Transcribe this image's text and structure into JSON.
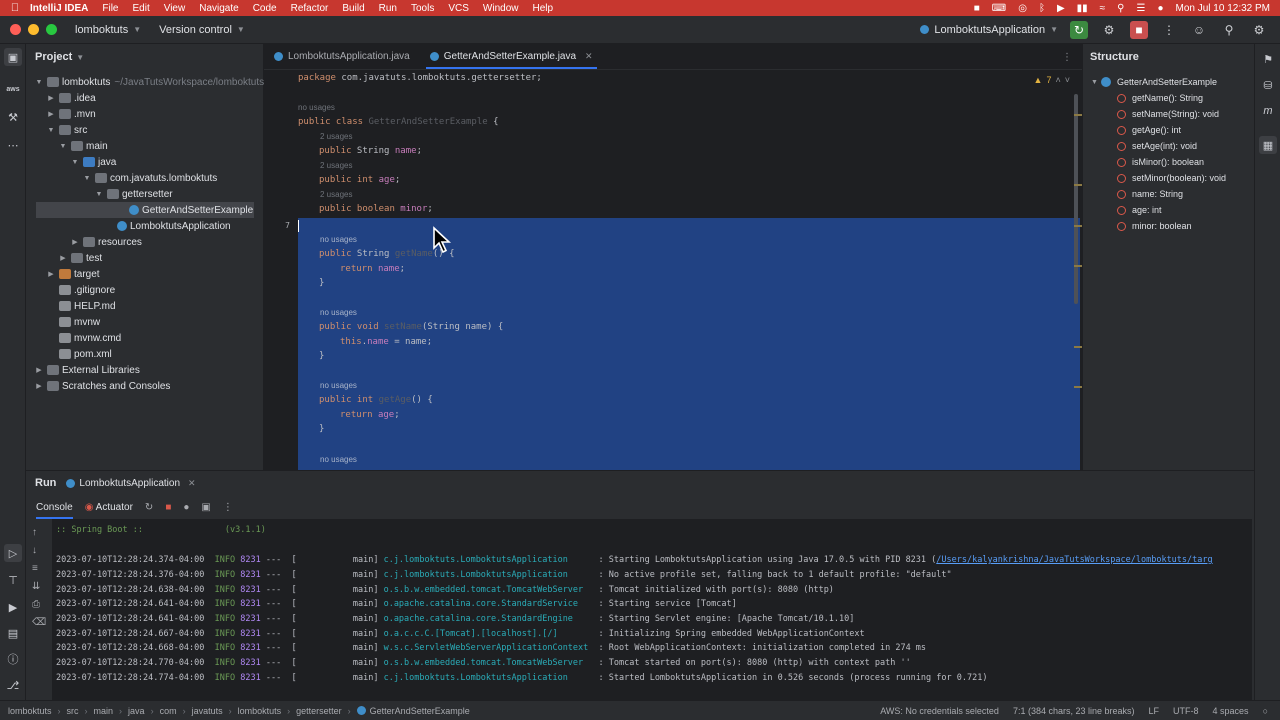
{
  "menubar": {
    "app": "IntelliJ IDEA",
    "items": [
      "File",
      "Edit",
      "View",
      "Navigate",
      "Code",
      "Refactor",
      "Build",
      "Run",
      "Tools",
      "VCS",
      "Window",
      "Help"
    ],
    "clock": "Mon Jul 10  12:32 PM"
  },
  "titlebar": {
    "project": "lomboktuts",
    "vcs": "Version control",
    "run_config": "LomboktutsApplication"
  },
  "project_panel": {
    "title": "Project",
    "root_path": "~/JavaTutsWorkspace/lomboktuts",
    "items": [
      {
        "label": "lomboktuts"
      },
      {
        "label": ".idea"
      },
      {
        "label": ".mvn"
      },
      {
        "label": "src"
      },
      {
        "label": "main"
      },
      {
        "label": "java"
      },
      {
        "label": "com.javatuts.lomboktuts"
      },
      {
        "label": "gettersetter"
      },
      {
        "label": "GetterAndSetterExample"
      },
      {
        "label": "LomboktutsApplication"
      },
      {
        "label": "resources"
      },
      {
        "label": "test"
      },
      {
        "label": "target"
      },
      {
        "label": ".gitignore"
      },
      {
        "label": "HELP.md"
      },
      {
        "label": "mvnw"
      },
      {
        "label": "mvnw.cmd"
      },
      {
        "label": "pom.xml"
      },
      {
        "label": "External Libraries"
      },
      {
        "label": "Scratches and Consoles"
      }
    ]
  },
  "editor": {
    "tabs": [
      {
        "label": "LomboktutsApplication.java"
      },
      {
        "label": "GetterAndSetterExample.java"
      }
    ],
    "warnings": "7",
    "line_numbers": [
      "",
      "",
      "",
      "",
      "",
      "",
      "",
      "7",
      "",
      "",
      "",
      "",
      "",
      "",
      "",
      "",
      "",
      "",
      "",
      "",
      "",
      "",
      "",
      "",
      ""
    ],
    "current_line": "7",
    "package_kw": "package",
    "package_name": " com.javatuts.lomboktuts.gettersetter;",
    "no_usages": "no usages",
    "usages_2": "2 usages",
    "public": "public",
    "class_kw": " class ",
    "class_name": "GetterAndSetterExample",
    "brace_open": " {",
    "brace_close": "}",
    "string_type": " String ",
    "int_type": " int ",
    "boolean_type": " boolean ",
    "void_type": " void ",
    "f_name": "name",
    "f_age": "age",
    "f_minor": "minor",
    "semicolon": ";",
    "getName": "getName",
    "setName": "setName",
    "getAge": "getAge",
    "paren_empty": "()",
    "param_string_name": "(String name)",
    "return_kw": "return",
    "this_kw": "this",
    "dot": ".",
    "assign_name": " = name;"
  },
  "structure": {
    "title": "Structure",
    "root": "GetterAndSetterExample",
    "members": [
      "getName(): String",
      "setName(String): void",
      "getAge(): int",
      "setAge(int): void",
      "isMinor(): boolean",
      "setMinor(boolean): void",
      "name: String",
      "age: int",
      "minor: boolean"
    ]
  },
  "run_panel": {
    "title": "Run",
    "tab": "LomboktutsApplication",
    "console_tab": "Console",
    "actuator_tab": "Actuator",
    "banner": ":: Spring Boot ::                (v3.1.1)",
    "logs": [
      {
        "ts": "2023-07-10T12:28:24.374-04:00",
        "level": "INFO",
        "pid": "8231",
        "thread": "---  [           main] ",
        "logger": "c.j.lomboktuts.LomboktutsApplication     ",
        "msg": " : Starting LomboktutsApplication using Java 17.0.5 with PID 8231 (",
        "url": "/Users/kalyankrishna/JavaTutsWorkspace/lomboktuts/targ"
      },
      {
        "ts": "2023-07-10T12:28:24.376-04:00",
        "level": "INFO",
        "pid": "8231",
        "thread": "---  [           main] ",
        "logger": "c.j.lomboktuts.LomboktutsApplication     ",
        "msg": " : No active profile set, falling back to 1 default profile: \"default\"",
        "url": ""
      },
      {
        "ts": "2023-07-10T12:28:24.638-04:00",
        "level": "INFO",
        "pid": "8231",
        "thread": "---  [           main] ",
        "logger": "o.s.b.w.embedded.tomcat.TomcatWebServer  ",
        "msg": " : Tomcat initialized with port(s): 8080 (http)",
        "url": ""
      },
      {
        "ts": "2023-07-10T12:28:24.641-04:00",
        "level": "INFO",
        "pid": "8231",
        "thread": "---  [           main] ",
        "logger": "o.apache.catalina.core.StandardService   ",
        "msg": " : Starting service [Tomcat]",
        "url": ""
      },
      {
        "ts": "2023-07-10T12:28:24.641-04:00",
        "level": "INFO",
        "pid": "8231",
        "thread": "---  [           main] ",
        "logger": "o.apache.catalina.core.StandardEngine    ",
        "msg": " : Starting Servlet engine: [Apache Tomcat/10.1.10]",
        "url": ""
      },
      {
        "ts": "2023-07-10T12:28:24.667-04:00",
        "level": "INFO",
        "pid": "8231",
        "thread": "---  [           main] ",
        "logger": "o.a.c.c.C.[Tomcat].[localhost].[/]       ",
        "msg": " : Initializing Spring embedded WebApplicationContext",
        "url": ""
      },
      {
        "ts": "2023-07-10T12:28:24.668-04:00",
        "level": "INFO",
        "pid": "8231",
        "thread": "---  [           main] ",
        "logger": "w.s.c.ServletWebServerApplicationContext ",
        "msg": " : Root WebApplicationContext: initialization completed in 274 ms",
        "url": ""
      },
      {
        "ts": "2023-07-10T12:28:24.770-04:00",
        "level": "INFO",
        "pid": "8231",
        "thread": "---  [           main] ",
        "logger": "o.s.b.w.embedded.tomcat.TomcatWebServer  ",
        "msg": " : Tomcat started on port(s): 8080 (http) with context path ''",
        "url": ""
      },
      {
        "ts": "2023-07-10T12:28:24.774-04:00",
        "level": "INFO",
        "pid": "8231",
        "thread": "---  [           main] ",
        "logger": "c.j.lomboktuts.LomboktutsApplication     ",
        "msg": " : Started LomboktutsApplication in 0.526 seconds (process running for 0.721)",
        "url": ""
      }
    ]
  },
  "statusbar": {
    "breadcrumbs": [
      "lomboktuts",
      "src",
      "main",
      "java",
      "com",
      "javatuts",
      "lomboktuts",
      "gettersetter",
      "GetterAndSetterExample"
    ],
    "aws": "AWS: No credentials selected",
    "position": "7:1 (384 chars, 23 line breaks)",
    "line_sep": "LF",
    "encoding": "UTF-8",
    "indent": "4 spaces"
  },
  "colors": {
    "menubar_bg": "#c7372f",
    "selection": "#214283",
    "accent": "#3574f0"
  }
}
